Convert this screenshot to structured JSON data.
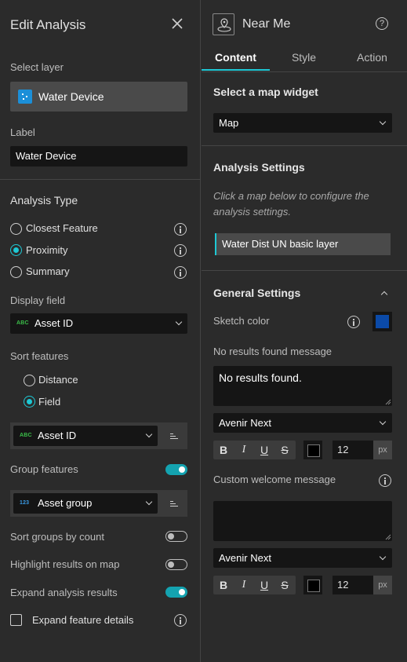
{
  "left": {
    "title": "Edit Analysis",
    "select_layer_label": "Select layer",
    "layer_name": "Water Device",
    "label_label": "Label",
    "label_value": "Water Device",
    "analysis_type_title": "Analysis Type",
    "analysis_types": [
      "Closest Feature",
      "Proximity",
      "Summary"
    ],
    "selected_analysis_type": "Proximity",
    "display_field_label": "Display field",
    "display_field_tag": "ABC",
    "display_field_value": "Asset ID",
    "sort_features_label": "Sort features",
    "sort_options": [
      "Distance",
      "Field"
    ],
    "selected_sort": "Field",
    "sort_field_tag": "ABC",
    "sort_field_value": "Asset ID",
    "group_features_label": "Group features",
    "group_features_on": true,
    "group_field_tag": "123",
    "group_field_value": "Asset group",
    "sort_groups_label": "Sort groups by count",
    "sort_groups_on": false,
    "highlight_label": "Highlight results on map",
    "highlight_on": false,
    "expand_results_label": "Expand analysis results",
    "expand_results_on": true,
    "expand_details_label": "Expand feature details",
    "expand_details_checked": false
  },
  "right": {
    "widget_title": "Near Me",
    "tabs": [
      "Content",
      "Style",
      "Action"
    ],
    "active_tab": "Content",
    "select_map_title": "Select a map widget",
    "map_widget_value": "Map",
    "analysis_settings_title": "Analysis Settings",
    "analysis_settings_hint": "Click a map below to configure the analysis settings.",
    "map_layer_item": "Water Dist UN basic layer",
    "general_settings_title": "General Settings",
    "sketch_color_label": "Sketch color",
    "sketch_color": "#0b4aa8",
    "no_results_label": "No results found message",
    "no_results_value": "No results found.",
    "font_1": "Avenir Next",
    "font_size_1": "12",
    "custom_welcome_label": "Custom welcome message",
    "custom_welcome_value": "",
    "font_2": "Avenir Next",
    "font_size_2": "12",
    "unit": "px",
    "format_buttons": [
      "B",
      "I",
      "U",
      "S"
    ]
  },
  "colors": {
    "accent": "#1ec8d4",
    "toggle_on": "#14a3b0",
    "background": "#2b2b2b",
    "field_bg": "#151515"
  }
}
